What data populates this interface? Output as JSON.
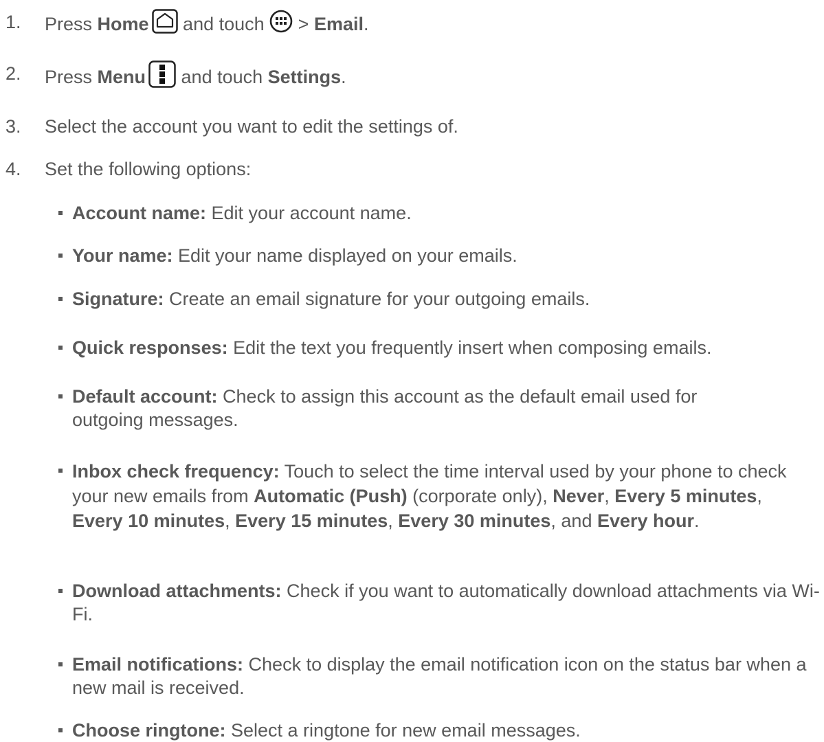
{
  "steps": [
    {
      "num": "1.",
      "parts": {
        "a": "Press ",
        "b": "Home",
        "c": " and touch ",
        "d": " > ",
        "e": "Email",
        "f": "."
      }
    },
    {
      "num": "2.",
      "parts": {
        "a": "Press ",
        "b": "Menu",
        "c": " and touch ",
        "d": "Settings",
        "e": "."
      }
    },
    {
      "num": "3.",
      "text": "Select the account you want to edit the settings of."
    },
    {
      "num": "4.",
      "text": "Set the following options:"
    }
  ],
  "options": [
    {
      "term": "Account name:",
      "desc": " Edit your account name."
    },
    {
      "term": "Your name:",
      "desc": " Edit your name displayed on your emails."
    },
    {
      "term": "Signature:",
      "desc": " Create an email signature for your outgoing emails."
    },
    {
      "term": "Quick responses:",
      "desc": " Edit the text you frequently insert when composing emails."
    },
    {
      "term": "Default account:",
      "desc": " Check to assign this account as the default email used for outgoing messages."
    },
    {
      "term": "Inbox check frequency:",
      "desc1": " Touch to select the time interval used by your phone to check your new emails from ",
      "v1": "Automatic (Push)",
      "desc2": " (corporate only), ",
      "v2": "Never",
      "s2": ", ",
      "v3": "Every 5 minutes",
      "s3": ", ",
      "v4": "Every 10 minutes",
      "s4": ", ",
      "v5": "Every 15 minutes",
      "s5": ", ",
      "v6": "Every 30 minutes",
      "s6": ", and ",
      "v7": "Every hour",
      "s7": "."
    },
    {
      "term": "Download attachments:",
      "desc": " Check if you want to automatically download attachments via Wi-Fi."
    },
    {
      "term": "Email notifications:",
      "desc": " Check to display the email notification icon on the status bar when a new mail is received."
    },
    {
      "term": "Choose ringtone:",
      "desc": " Select a ringtone for new email messages."
    }
  ],
  "icons": {
    "home": "home-icon",
    "apps": "apps-icon",
    "menu": "menu-icon"
  }
}
